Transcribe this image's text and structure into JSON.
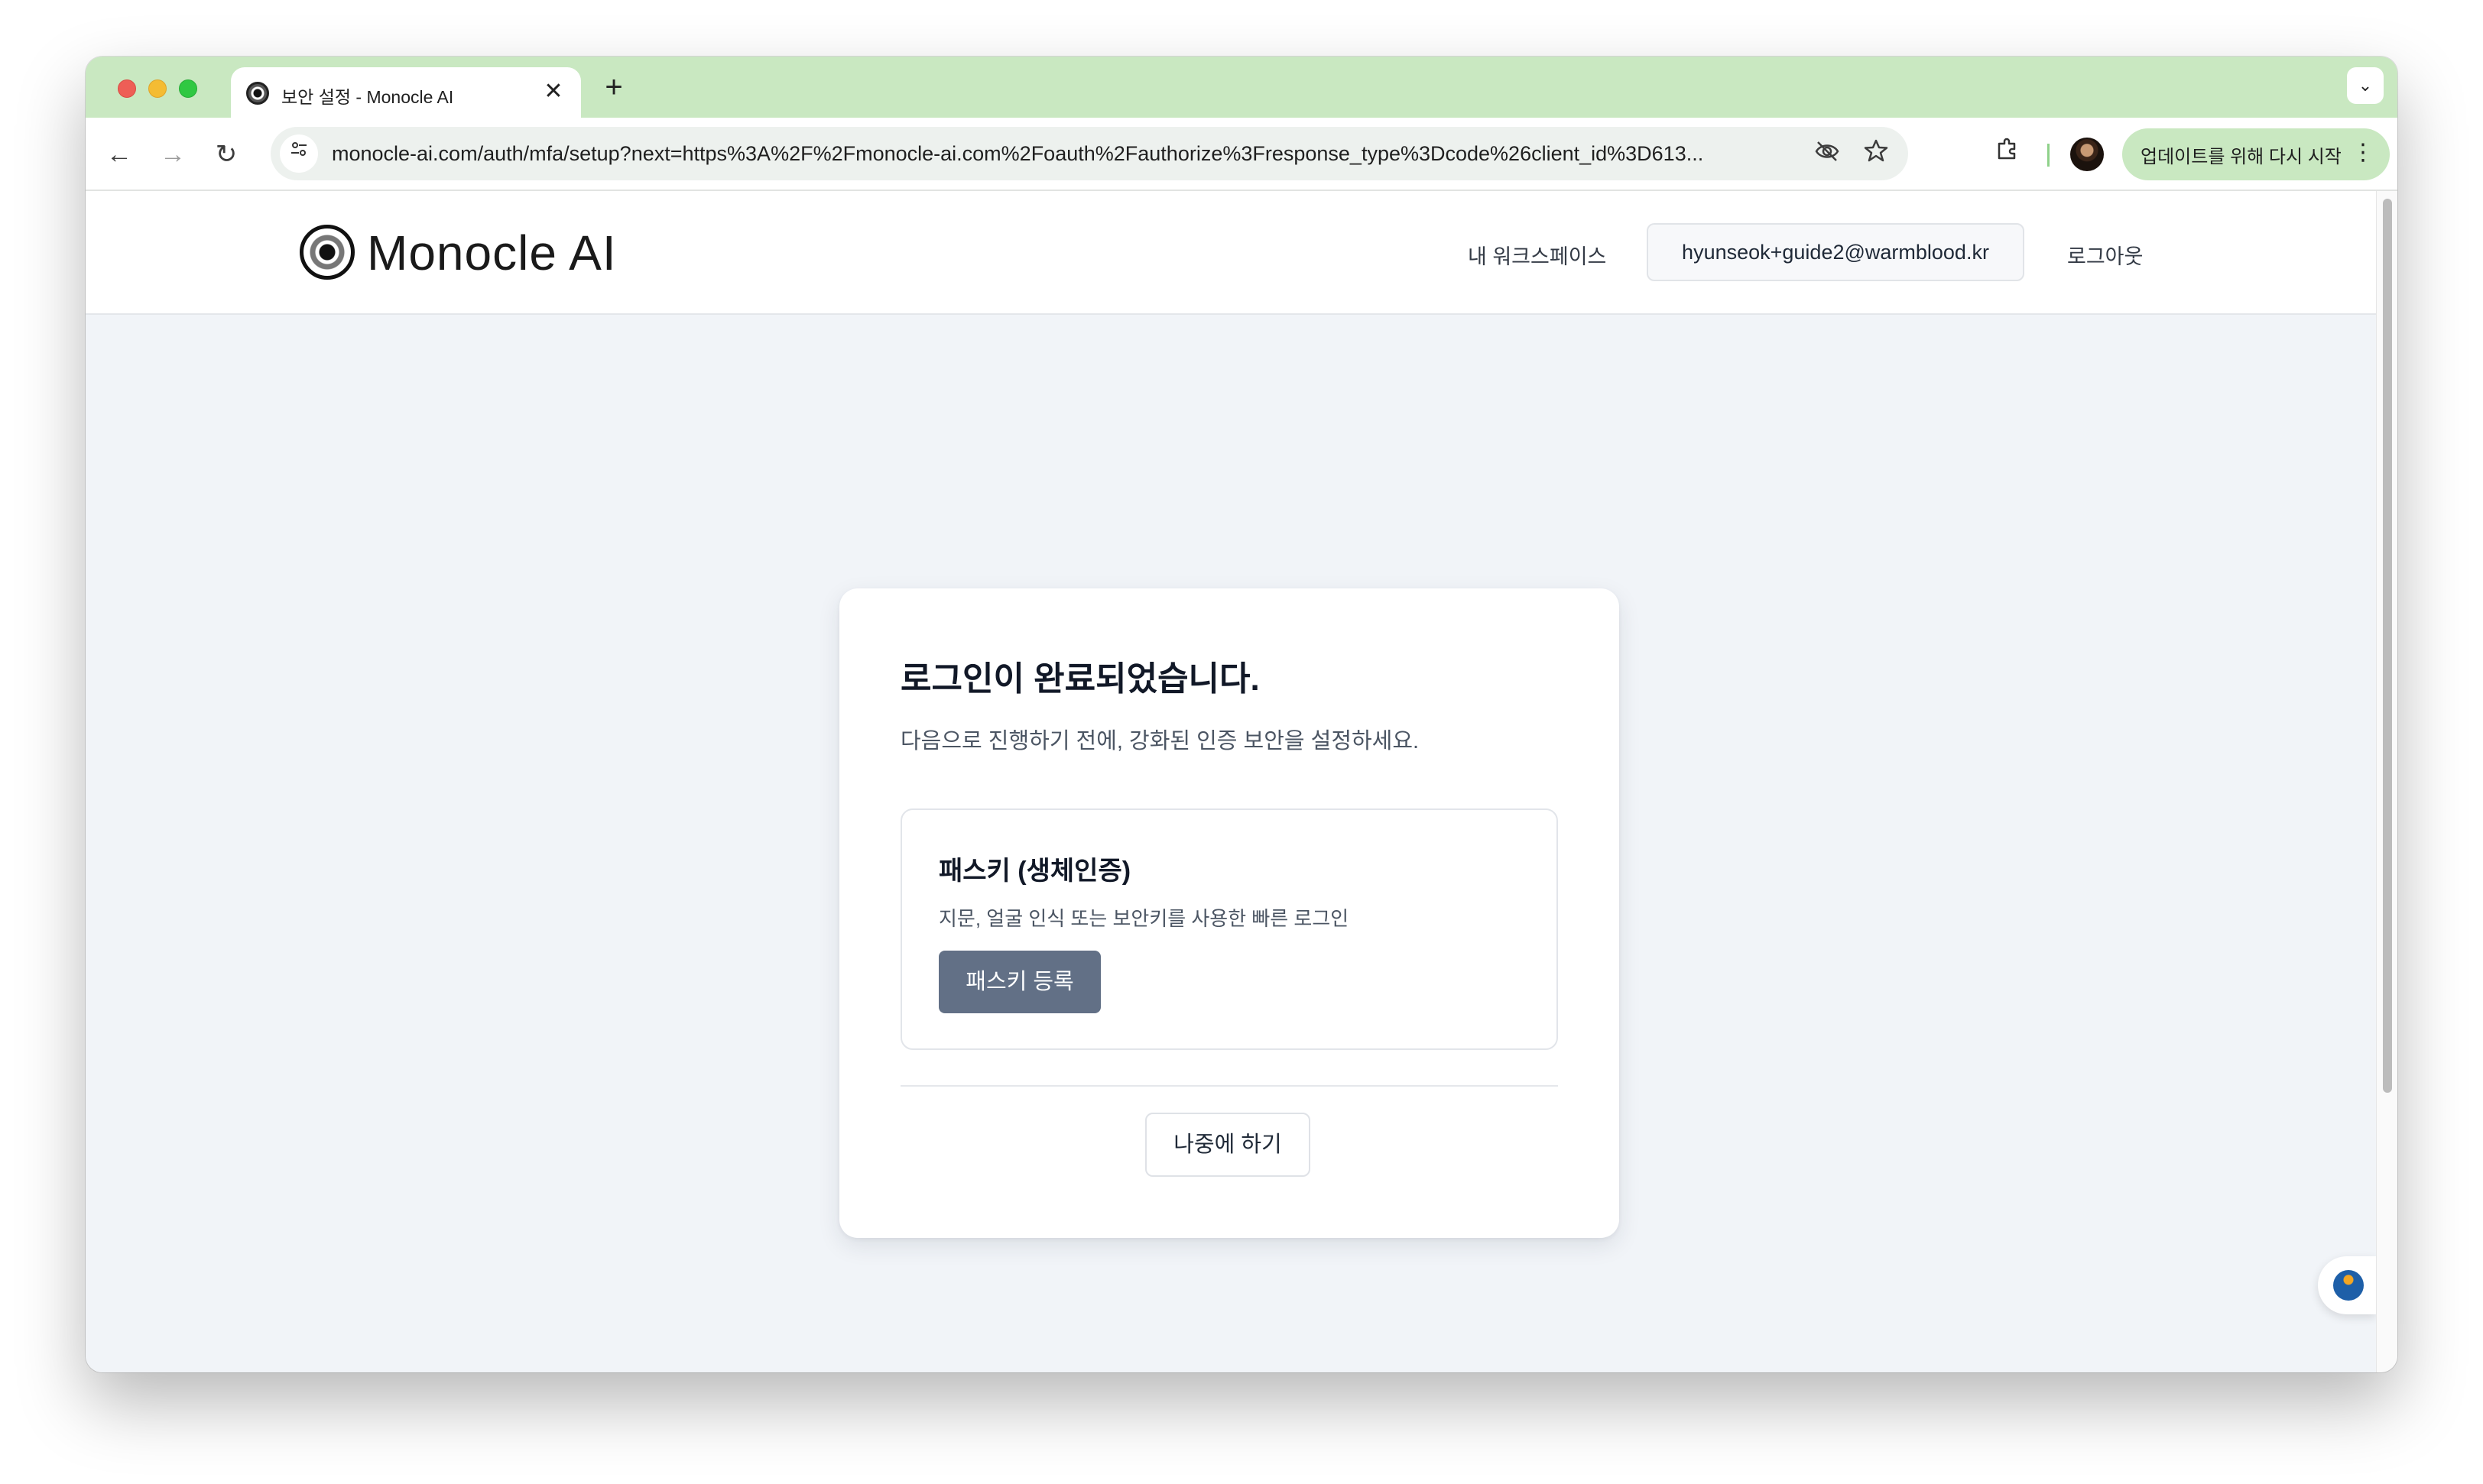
{
  "browser": {
    "tab_title": "보안 설정 - Monocle AI",
    "tab_close": "✕",
    "new_tab": "+",
    "tab_search": "⌄",
    "back": "←",
    "forward": "→",
    "reload": "↻",
    "url": "monocle-ai.com/auth/mfa/setup?next=https%3A%2F%2Fmonocle-ai.com%2Foauth%2Fauthorize%3Fresponse_type%3Dcode%26client_id%3D613...",
    "update_label": "업데이트를 위해 다시 시작",
    "update_menu": "⋮",
    "icons": {
      "site_info": "tune-icon",
      "eye_off": "eye-off-icon",
      "star": "star-icon",
      "extensions": "puzzle-icon"
    },
    "colors": {
      "tab_strip": "#c9e8c1",
      "update_button": "#c9e8c1"
    }
  },
  "site": {
    "logo_text": "Monocle AI",
    "nav": {
      "workspace": "내 워크스페이스",
      "user_email": "hyunseok+guide2@warmblood.kr",
      "logout": "로그아웃"
    }
  },
  "card": {
    "title": "로그인이 완료되었습니다.",
    "subtitle": "다음으로 진행하기 전에, 강화된 인증 보안을 설정하세요.",
    "method": {
      "title": "패스키 (생체인증)",
      "description": "지문, 얼굴 인식 또는 보안키를 사용한 빠른 로그인",
      "button": "패스키 등록"
    },
    "later_button": "나중에 하기",
    "colors": {
      "primary_button": "#627086"
    }
  }
}
